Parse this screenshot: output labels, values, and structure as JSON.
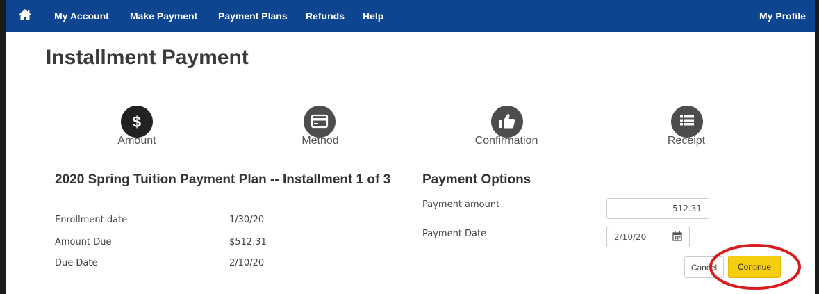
{
  "nav": {
    "home_icon": "home-icon",
    "items": [
      "My Account",
      "Make Payment",
      "Payment Plans",
      "Refunds",
      "Help"
    ],
    "profile": "My Profile",
    "color": "#0d4591"
  },
  "page_title": "Installment Payment",
  "steps": [
    {
      "label": "Amount",
      "icon": "dollar-icon",
      "active": true
    },
    {
      "label": "Method",
      "icon": "credit-card-icon",
      "active": false
    },
    {
      "label": "Confirmation",
      "icon": "thumbs-up-icon",
      "active": false
    },
    {
      "label": "Receipt",
      "icon": "list-icon",
      "active": false
    }
  ],
  "plan": {
    "title": "2020 Spring Tuition Payment Plan -- Installment 1 of 3",
    "rows": [
      {
        "label": "Enrollment date",
        "value": "1/30/20"
      },
      {
        "label": "Amount Due",
        "value": "$512.31"
      },
      {
        "label": "Due Date",
        "value": "2/10/20"
      }
    ]
  },
  "options": {
    "title": "Payment Options",
    "amount_label": "Payment amount",
    "amount_value": "512.31",
    "date_label": "Payment Date",
    "date_value": "2/10/20",
    "calendar_icon": "calendar-icon"
  },
  "buttons": {
    "cancel": "Cancel",
    "continue": "Continue",
    "continue_color": "#f5cf0f"
  },
  "annotation": {
    "shape": "ellipse",
    "color": "#d91c1c"
  }
}
